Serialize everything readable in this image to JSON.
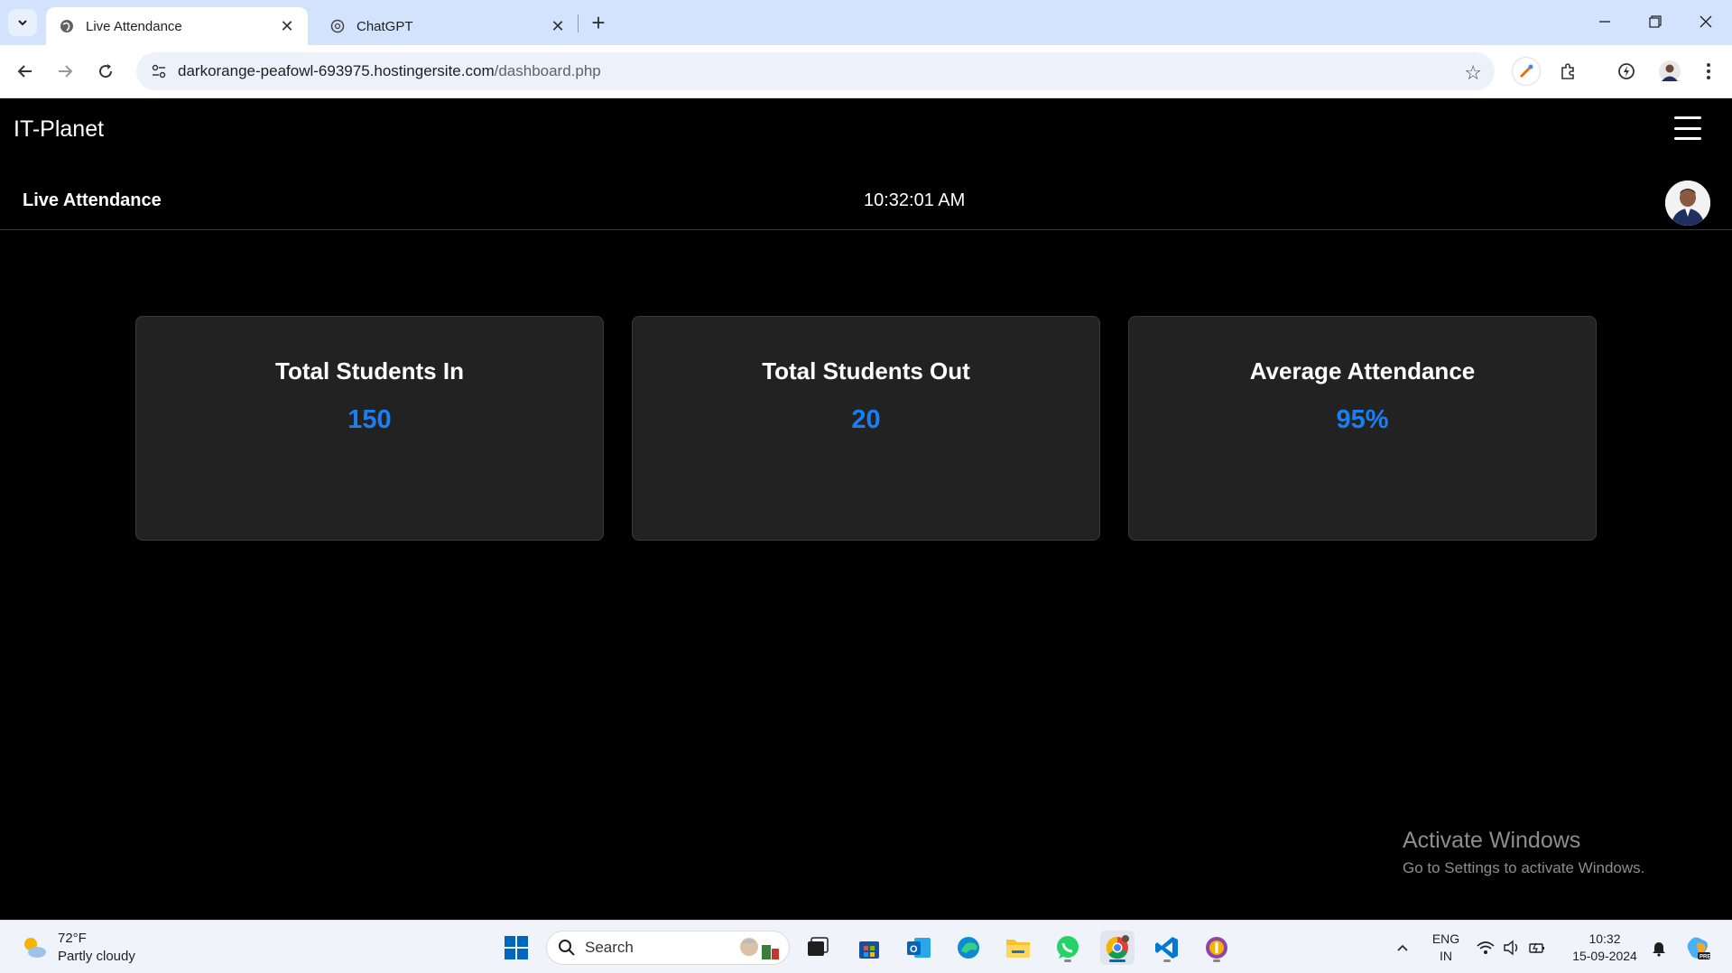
{
  "browser": {
    "tabs": [
      {
        "title": "Live Attendance",
        "active": true
      },
      {
        "title": "ChatGPT",
        "active": false
      }
    ],
    "url_host": "darkorange-peafowl-693975.hostingersite.com",
    "url_path": "/dashboard.php"
  },
  "app": {
    "brand": "IT-Planet",
    "page_title": "Live Attendance",
    "clock": "10:32:01 AM"
  },
  "cards": [
    {
      "title": "Total Students In",
      "value": "150"
    },
    {
      "title": "Total Students Out",
      "value": "20"
    },
    {
      "title": "Average Attendance",
      "value": "95%"
    }
  ],
  "watermark": {
    "line1": "Activate Windows",
    "line2": "Go to Settings to activate Windows."
  },
  "taskbar": {
    "weather_temp": "72°F",
    "weather_desc": "Partly cloudy",
    "search_label": "Search",
    "lang_top": "ENG",
    "lang_bottom": "IN",
    "time": "10:32",
    "date": "15-09-2024"
  },
  "colors": {
    "accent": "#1a7ff0",
    "card_bg": "#222222",
    "page_bg": "#000000",
    "chrome_tabbar": "#d3e3fd"
  }
}
